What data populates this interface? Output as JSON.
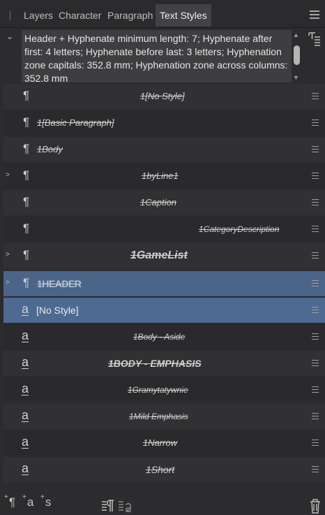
{
  "tabs": [
    {
      "label": "Layers",
      "active": false
    },
    {
      "label": "Character",
      "active": false
    },
    {
      "label": "Paragraph",
      "active": false
    },
    {
      "label": "Text Styles",
      "active": true
    }
  ],
  "description": "Header + Hyphenate minimum length: 7; Hyphenate after first: 4 letters; Hyphenate before last: 3 letters; Hyphenation zone capitals: 352.8 mm; Hyphenation zone across columns: 352.8 mm",
  "styles": [
    {
      "label": "1[No Style]",
      "type": "paragraph"
    },
    {
      "label": "1[Basic Paragraph]",
      "type": "paragraph"
    },
    {
      "label": "1Body",
      "type": "paragraph"
    },
    {
      "label": "1byLine1",
      "type": "paragraph",
      "expandable": true
    },
    {
      "label": "1Caption",
      "type": "paragraph"
    },
    {
      "label": "1CategoryDescription",
      "type": "paragraph"
    },
    {
      "label": "1GameList",
      "type": "paragraph",
      "expandable": true
    },
    {
      "label": "1HEADER",
      "type": "paragraph",
      "expandable": true,
      "selected": true
    },
    {
      "label": "[No Style]",
      "type": "character",
      "selected": true
    },
    {
      "label": "1Body - Aside",
      "type": "character"
    },
    {
      "label": "1BODY - EMPHASIS",
      "type": "character"
    },
    {
      "label": "1Gramytatywnie",
      "type": "character"
    },
    {
      "label": "1Mild Emphasis",
      "type": "character"
    },
    {
      "label": "1Narrow",
      "type": "character"
    },
    {
      "label": "1Short",
      "type": "character"
    }
  ],
  "glyphs": {
    "paragraph": "¶",
    "character": "a"
  },
  "bottom": {
    "add_paragraph": "¶",
    "add_character": "a",
    "add_group": "s",
    "plus": "+"
  },
  "colors": {
    "selection": "#4b6588",
    "panel": "#2c2c2e",
    "row": "#313134"
  }
}
